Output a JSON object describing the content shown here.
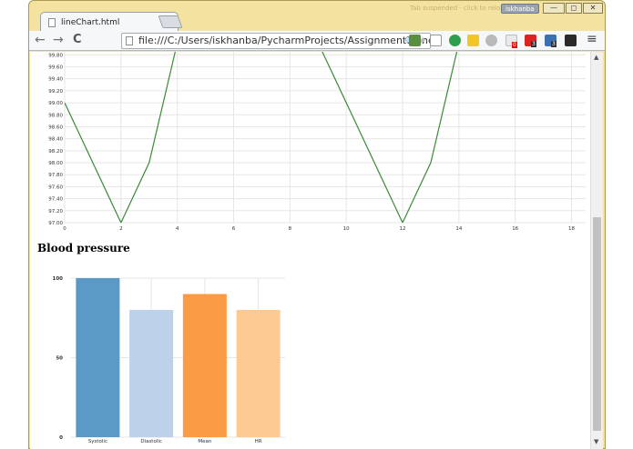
{
  "window": {
    "tab_title": "lineChart.html",
    "tab_close": "×",
    "faded_status": "Tab suspended · click to reload",
    "user_badge": "iskhanba",
    "minimize": "—",
    "restore": "◻",
    "close": "✕"
  },
  "toolbar": {
    "back": "←",
    "forward": "→",
    "reload": "C",
    "url": "file:///C:/Users/iskhanba/PycharmProjects/Assignment1/lineCl",
    "search_glyph": "🔍",
    "bookmark_glyph": "★",
    "menu_glyph": "≡",
    "badges": [
      "0",
      "3",
      "3"
    ]
  },
  "colors": {
    "line": "#3a8a3a",
    "bar_systolic": "#5b99c7",
    "bar_diastolic": "#bcd2ea",
    "bar_mean": "#fc9b46",
    "bar_hr": "#fdca93",
    "grid": "#e6e6e6"
  },
  "section": {
    "blood_pressure_title": "Blood pressure"
  },
  "chart_data": [
    {
      "type": "line",
      "title": "",
      "xlabel": "",
      "ylabel": "",
      "x_ticks": [
        0,
        2,
        4,
        6,
        8,
        10,
        12,
        14,
        16,
        18
      ],
      "y_ticks": [
        "97.00",
        "97.20",
        "97.40",
        "97.60",
        "97.80",
        "98.00",
        "98.20",
        "98.40",
        "98.60",
        "98.80",
        "99.00",
        "99.20",
        "99.40",
        "99.60",
        "99.80"
      ],
      "xlim": [
        0,
        18.5
      ],
      "ylim": [
        97.0,
        99.85
      ],
      "grid": true,
      "series": [
        {
          "x": [
            0,
            2,
            3,
            4,
            9,
            12,
            13,
            14
          ],
          "y": [
            99.0,
            97.0,
            98.0,
            100.0,
            100.0,
            97.0,
            98.0,
            100.0
          ]
        }
      ]
    },
    {
      "type": "bar",
      "title": "Blood pressure",
      "categories": [
        "Systolic",
        "Diastolic",
        "Mean",
        "HR"
      ],
      "values": [
        100,
        80,
        90,
        80
      ],
      "y_ticks": [
        0,
        50,
        100
      ],
      "ylim": [
        0,
        100
      ],
      "grid": true
    }
  ]
}
